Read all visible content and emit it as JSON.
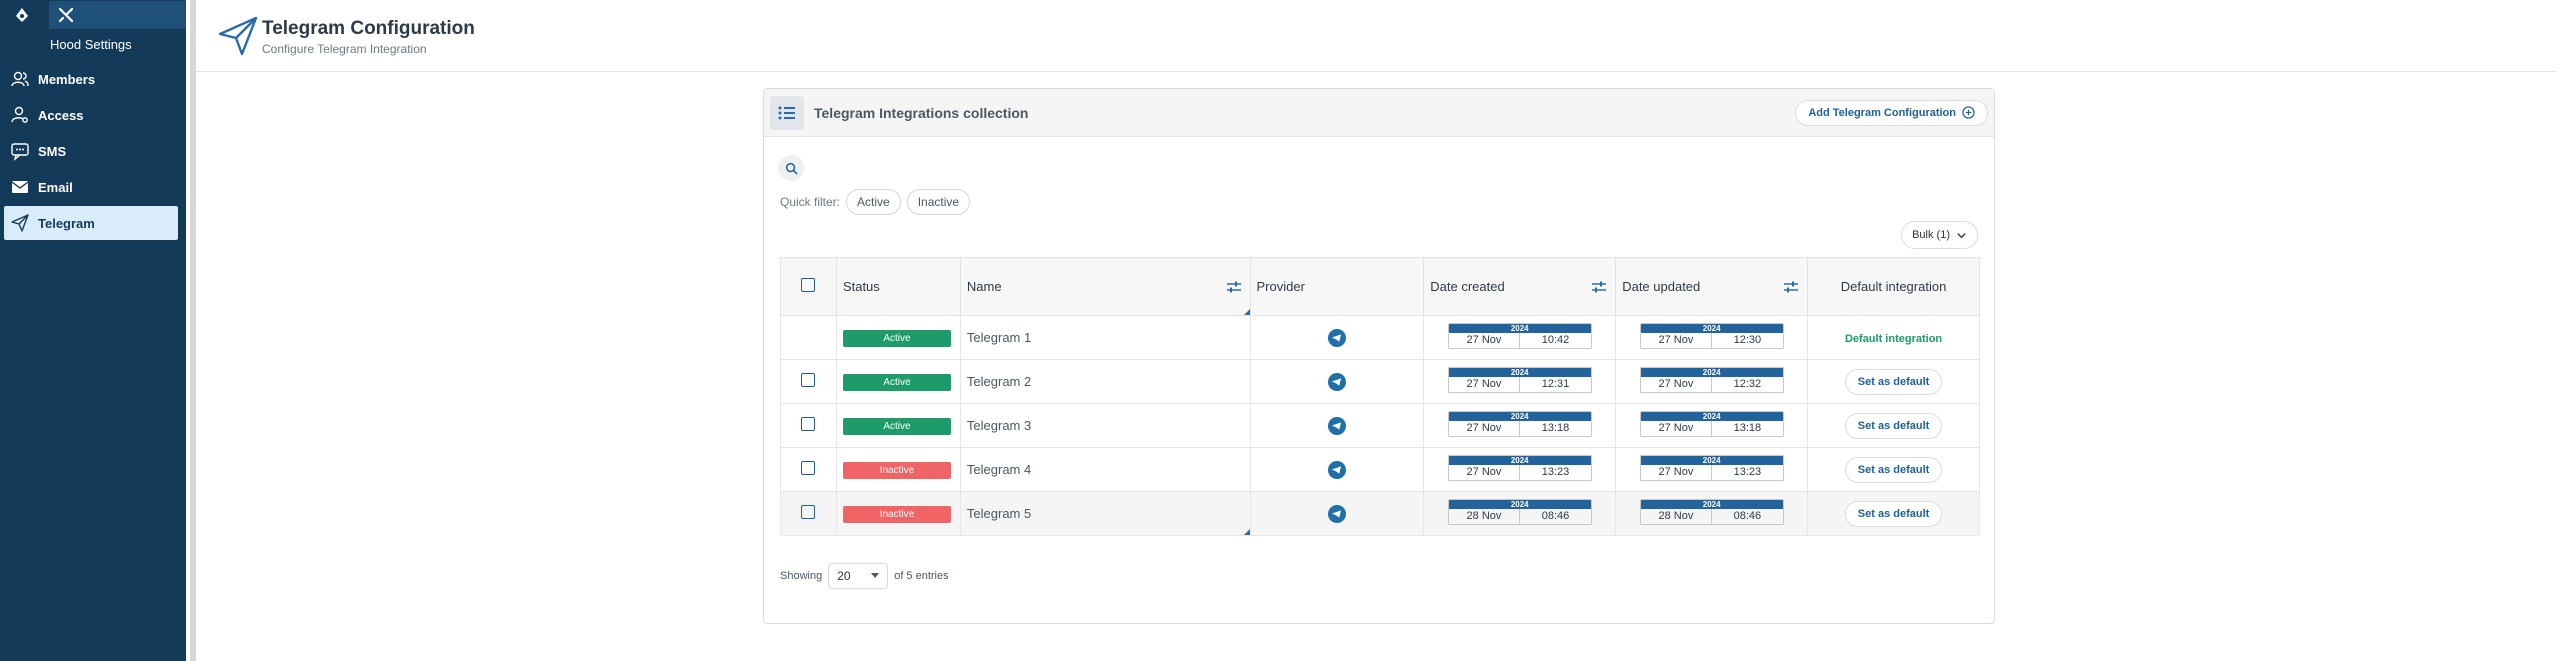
{
  "sidebar": {
    "title": "Hood Settings",
    "items": [
      {
        "label": "Members",
        "icon": "users-icon"
      },
      {
        "label": "Access",
        "icon": "user-key-icon"
      },
      {
        "label": "SMS",
        "icon": "chat-icon"
      },
      {
        "label": "Email",
        "icon": "envelope-icon"
      },
      {
        "label": "Telegram",
        "icon": "paper-plane-icon",
        "active": true
      }
    ]
  },
  "header": {
    "title": "Telegram Configuration",
    "subtitle": "Configure Telegram Integration"
  },
  "card": {
    "title": "Telegram Integrations collection",
    "add_label": "Add Telegram Configuration",
    "quick_filter_label": "Quick filter:",
    "filters": [
      "Active",
      "Inactive"
    ],
    "bulk_label": "Bulk (1)"
  },
  "table": {
    "columns": [
      "Status",
      "Name",
      "Provider",
      "Date created",
      "Date updated",
      "Default integration"
    ],
    "rows": [
      {
        "status": "Active",
        "name": "Telegram 1",
        "created": {
          "year": "2024",
          "day": "27 Nov",
          "time": "10:42"
        },
        "updated": {
          "year": "2024",
          "day": "27 Nov",
          "time": "12:30"
        },
        "default": "Default integration",
        "is_default": true
      },
      {
        "status": "Active",
        "name": "Telegram 2",
        "created": {
          "year": "2024",
          "day": "27 Nov",
          "time": "12:31"
        },
        "updated": {
          "year": "2024",
          "day": "27 Nov",
          "time": "12:32"
        },
        "default": "Set as default",
        "is_default": false
      },
      {
        "status": "Active",
        "name": "Telegram 3",
        "created": {
          "year": "2024",
          "day": "27 Nov",
          "time": "13:18"
        },
        "updated": {
          "year": "2024",
          "day": "27 Nov",
          "time": "13:18"
        },
        "default": "Set as default",
        "is_default": false
      },
      {
        "status": "Inactive",
        "name": "Telegram 4",
        "created": {
          "year": "2024",
          "day": "27 Nov",
          "time": "13:23"
        },
        "updated": {
          "year": "2024",
          "day": "27 Nov",
          "time": "13:23"
        },
        "default": "Set as default",
        "is_default": false
      },
      {
        "status": "Inactive",
        "name": "Telegram 5",
        "created": {
          "year": "2024",
          "day": "28 Nov",
          "time": "08:46"
        },
        "updated": {
          "year": "2024",
          "day": "28 Nov",
          "time": "08:46"
        },
        "default": "Set as default",
        "is_default": false
      }
    ]
  },
  "footer": {
    "showing": "Showing",
    "page_size": "20",
    "of_entries": "of 5 entries"
  },
  "colors": {
    "sidebar_bg": "#143a5a",
    "active_status": "#1e9b6a",
    "inactive_status": "#f06466",
    "accent": "#1f5f9a"
  }
}
